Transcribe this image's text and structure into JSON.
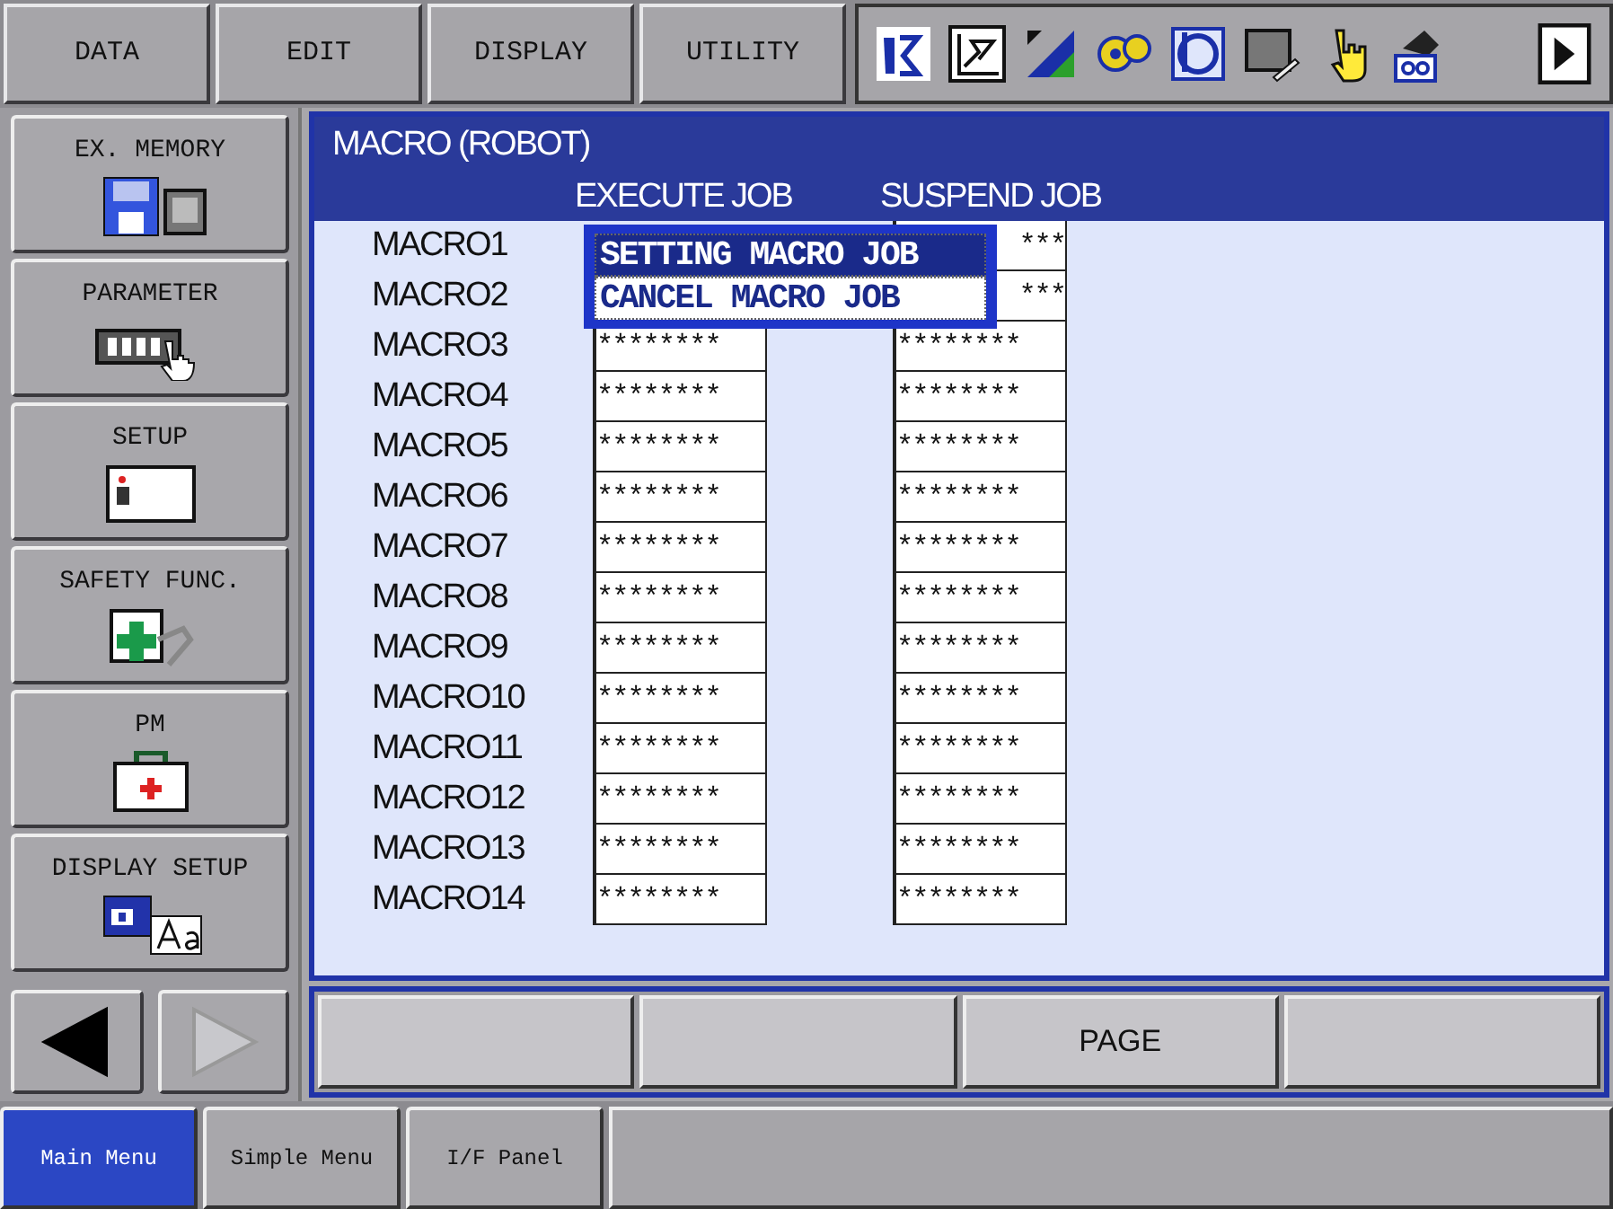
{
  "top_menu": [
    {
      "label": "DATA"
    },
    {
      "label": "EDIT"
    },
    {
      "label": "DISPLAY"
    },
    {
      "label": "UTILITY"
    }
  ],
  "sidebar": {
    "items": [
      {
        "label": "EX. MEMORY"
      },
      {
        "label": "PARAMETER"
      },
      {
        "label": "SETUP"
      },
      {
        "label": "SAFETY FUNC."
      },
      {
        "label": "PM"
      },
      {
        "label": "DISPLAY SETUP"
      }
    ],
    "arrows": [
      {
        "disabled": false
      },
      {
        "disabled": true
      }
    ]
  },
  "panel": {
    "title": "MACRO (ROBOT)",
    "columns": [
      "EXECUTE JOB",
      "SUSPEND JOB"
    ],
    "rows": [
      {
        "name": "MACRO1",
        "suspend_job": "***"
      },
      {
        "name": "MACRO2",
        "suspend_job": "***"
      },
      {
        "name": "MACRO3",
        "execute_job": "********",
        "suspend_job": "********"
      },
      {
        "name": "MACRO4",
        "execute_job": "********",
        "suspend_job": "********"
      },
      {
        "name": "MACRO5",
        "execute_job": "********",
        "suspend_job": "********"
      },
      {
        "name": "MACRO6",
        "execute_job": "********",
        "suspend_job": "********"
      },
      {
        "name": "MACRO7",
        "execute_job": "********",
        "suspend_job": "********"
      },
      {
        "name": "MACRO8",
        "execute_job": "********",
        "suspend_job": "********"
      },
      {
        "name": "MACRO9",
        "execute_job": "********",
        "suspend_job": "********"
      },
      {
        "name": "MACRO10",
        "execute_job": "********",
        "suspend_job": "********"
      },
      {
        "name": "MACRO11",
        "execute_job": "********",
        "suspend_job": "********"
      },
      {
        "name": "MACRO12",
        "execute_job": "********",
        "suspend_job": "********"
      },
      {
        "name": "MACRO13",
        "execute_job": "********",
        "suspend_job": "********"
      },
      {
        "name": "MACRO14",
        "execute_job": "********",
        "suspend_job": "********"
      }
    ],
    "popup": [
      {
        "label": "SETTING MACRO JOB",
        "selected": true
      },
      {
        "label": "CANCEL MACRO JOB",
        "selected": false
      }
    ]
  },
  "function_keys": [
    {
      "kind": "blank"
    },
    {
      "kind": "blank"
    },
    {
      "kind": "label",
      "label": "PAGE"
    },
    {
      "kind": "blank"
    }
  ],
  "bottom_tabs": [
    {
      "label": "Main Menu",
      "selected": true
    },
    {
      "label": "Simple Menu",
      "selected": false
    },
    {
      "label": "I/F Panel",
      "selected": false
    }
  ]
}
